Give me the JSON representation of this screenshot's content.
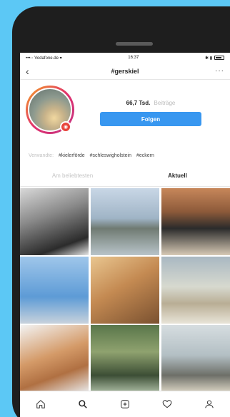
{
  "status": {
    "carrier": "•••◦◦ Vodafone.de ▾",
    "time": "16:37",
    "right": "✱ ▮"
  },
  "nav": {
    "back_icon": "‹",
    "title": "#gerskiel",
    "more_icon": "···"
  },
  "profile": {
    "count": "66,7 Tsd.",
    "count_label": "Beiträge",
    "follow_label": "Folgen",
    "badge": "◉"
  },
  "hashtags": [
    "Verwandte:",
    "#kielerförde",
    "#schleswigholstein",
    "#eckern"
  ],
  "tabs": {
    "top": "Am beliebtesten",
    "recent": "Aktuell"
  },
  "grid": {
    "tiles": [
      "photo-1",
      "photo-2",
      "photo-3",
      "photo-4",
      "photo-5",
      "photo-6",
      "photo-7",
      "photo-8",
      "photo-9"
    ]
  },
  "bottom_nav": {
    "icons": [
      "home-icon",
      "search-icon",
      "add-icon",
      "heart-icon",
      "profile-icon"
    ]
  },
  "colors": {
    "background": "#5cc8f5",
    "follow_button": "#3897f0",
    "story_ring_start": "#f5a623",
    "story_ring_end": "#c13584"
  }
}
